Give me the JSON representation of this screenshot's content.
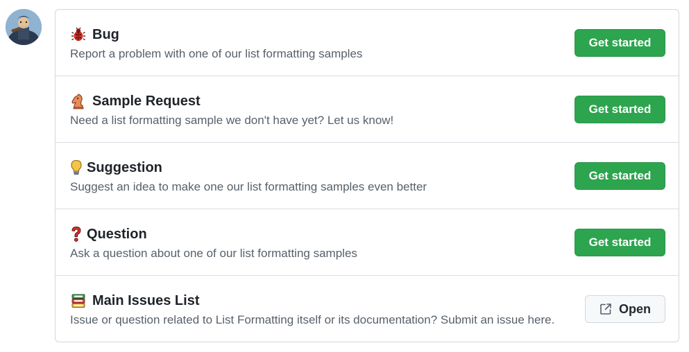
{
  "templates": [
    {
      "icon": "bug-icon",
      "title": "Bug",
      "description": "Report a problem with one of our list formatting samples",
      "button_label": "Get started"
    },
    {
      "icon": "chess-knight-icon",
      "title": "Sample Request",
      "description": "Need a list formatting sample we don't have yet? Let us know!",
      "button_label": "Get started"
    },
    {
      "icon": "light-bulb-icon",
      "title": "Suggestion",
      "description": "Suggest an idea to make one our list formatting samples even better",
      "button_label": "Get started"
    },
    {
      "icon": "question-mark-icon",
      "title": "Question",
      "description": "Ask a question about one of our list formatting samples",
      "button_label": "Get started"
    }
  ],
  "external_link": {
    "icon": "books-icon",
    "title": "Main Issues List",
    "description": "Issue or question related to List Formatting itself or its documentation? Submit an issue here.",
    "button_label": "Open",
    "button_icon": "external-link-icon"
  },
  "colors": {
    "primary_button": "#2da44e",
    "border": "#d0d7de",
    "muted_text": "#57606a"
  }
}
